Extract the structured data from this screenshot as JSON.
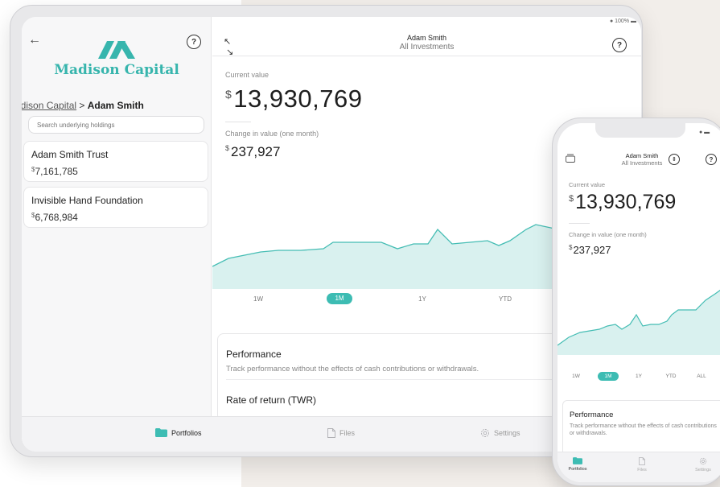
{
  "tablet": {
    "brand": "Madison Capital",
    "breadcrumb": {
      "parent": "adison Capital",
      "separator": ">",
      "current": "Adam Smith"
    },
    "search_placeholder": "Search underlying holdings",
    "holdings": [
      {
        "name": "Adam Smith Trust",
        "currency": "$",
        "value": "7,161,785"
      },
      {
        "name": "Invisible Hand Foundation",
        "currency": "$",
        "value": "6,768,984"
      }
    ],
    "header": {
      "title": "Adam Smith",
      "subtitle": "All Investments",
      "battery": "100%"
    },
    "current_value_label": "Current value",
    "current_value_currency": "$",
    "current_value": "13,930,769",
    "change_label": "Change in value (one month)",
    "change_currency": "$",
    "change_value": "237,927",
    "ranges": [
      "1W",
      "1M",
      "1Y",
      "YTD"
    ],
    "active_range": "1M",
    "performance": {
      "title": "Performance",
      "description": "Track performance without the effects of cash contributions or withdrawals.",
      "rate_label": "Rate of return (TWR)"
    },
    "tabs": [
      "Portfolios",
      "Files",
      "Settings"
    ],
    "help": "?"
  },
  "phone": {
    "header": {
      "title": "Adam Smith",
      "subtitle": "All Investments"
    },
    "current_value_label": "Current value",
    "current_value_currency": "$",
    "current_value": "13,930,769",
    "change_label": "Change in value (one month)",
    "change_currency": "$",
    "change_value": "237,927",
    "ranges": [
      "1W",
      "1M",
      "1Y",
      "YTD",
      "ALL"
    ],
    "performance": {
      "title": "Performance",
      "description": "Track performance without the effects of cash contributions or withdrawals."
    },
    "tabs": [
      "Portfolios",
      "Files",
      "Settings"
    ],
    "help": "?"
  },
  "colors": {
    "accent": "#3dbcb3",
    "brand": "#37b5ad",
    "area_fill": "#d9f1ef"
  },
  "icons": {
    "back": "arrow-left-icon",
    "expand": "expand-icon",
    "folder": "folder-icon",
    "file": "file-icon",
    "gear": "gear-icon"
  }
}
